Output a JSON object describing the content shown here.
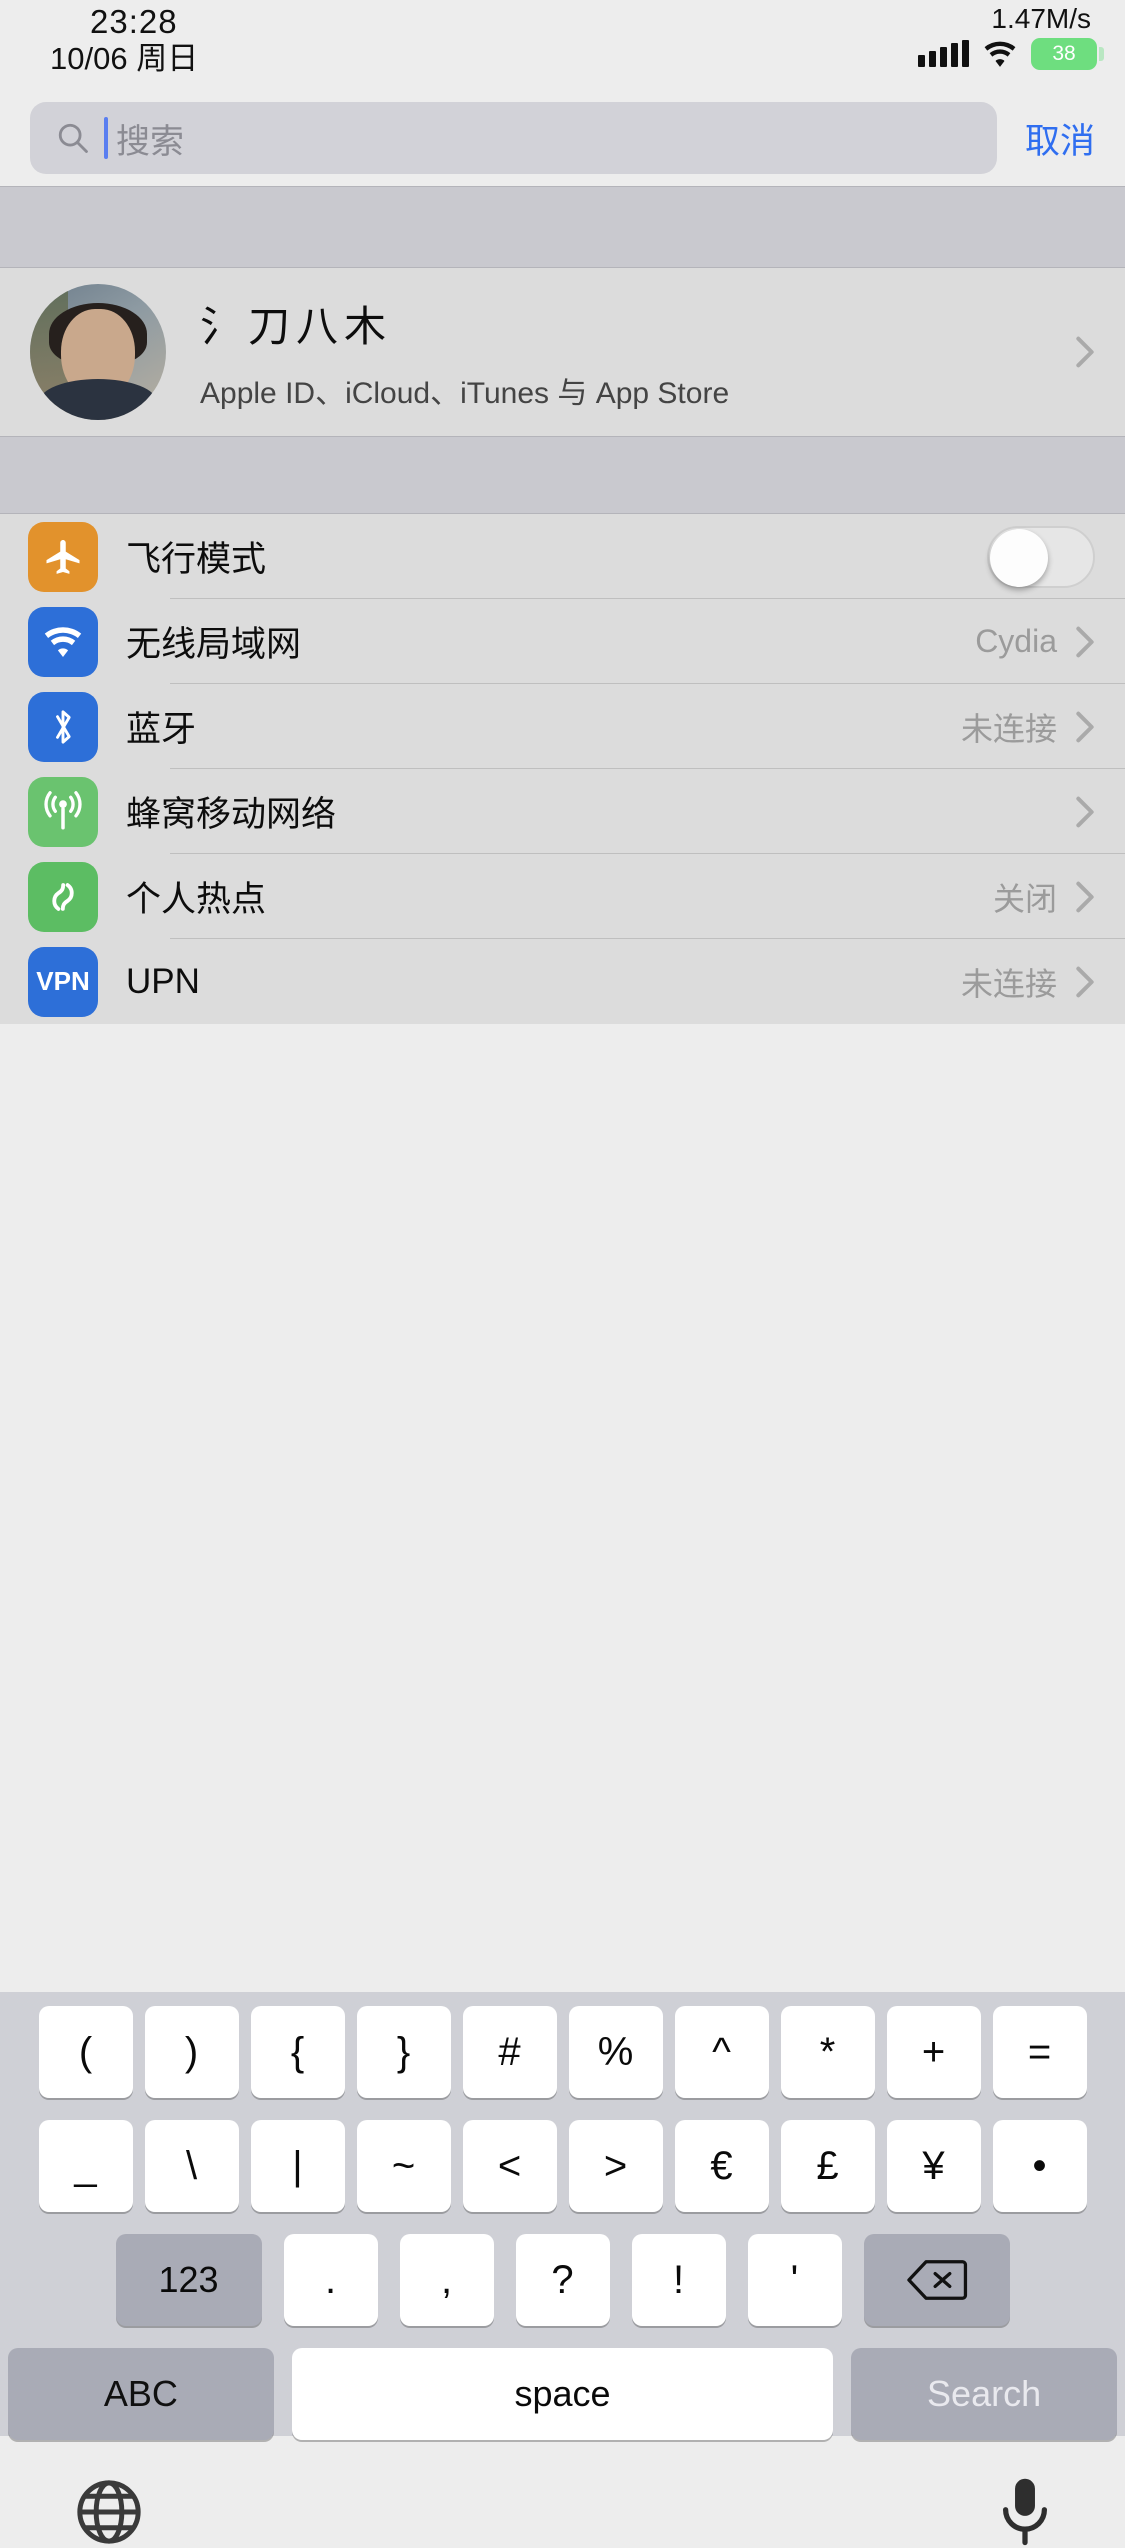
{
  "statusbar": {
    "time": "23:28",
    "date": "10/06 周日",
    "network_speed": "1.47M/s",
    "battery_level": "38",
    "battery_color": "#6ede7f",
    "signal_icon": "cellular-bars-icon",
    "wifi_icon": "wifi-icon"
  },
  "search": {
    "placeholder": "搜索",
    "value": "",
    "cancel_label": "取消",
    "icon": "search-icon",
    "accent_color": "#2f6ef0"
  },
  "profile": {
    "name": "氵刀八木",
    "subtitle": "Apple ID、iCloud、iTunes 与 App Store",
    "avatar": "user-avatar"
  },
  "settings": {
    "rows": [
      {
        "label": "飞行模式",
        "value": "",
        "icon": "airplane-icon",
        "control": "toggle",
        "toggle_on": false,
        "accent": "#e2922c"
      },
      {
        "label": "无线局域网",
        "value": "Cydia",
        "icon": "wifi-icon",
        "control": "chevron",
        "accent": "#2d6fd8"
      },
      {
        "label": "蓝牙",
        "value": "未连接",
        "icon": "bluetooth-icon",
        "control": "chevron",
        "accent": "#2d6fd8"
      },
      {
        "label": "蜂窝移动网络",
        "value": "",
        "icon": "cellular-icon",
        "control": "chevron",
        "accent": "#6ac36f"
      },
      {
        "label": "个人热点",
        "value": "关闭",
        "icon": "hotspot-icon",
        "control": "chevron",
        "accent": "#5cbd63"
      },
      {
        "label": "UPN",
        "value": "未连接",
        "icon": "vpn-icon",
        "icon_text": "VPN",
        "control": "chevron",
        "accent": "#2d6fd8"
      }
    ]
  },
  "keyboard": {
    "layout": "symbols",
    "row1": [
      "(",
      ")",
      "{",
      "}",
      "#",
      "%",
      "^",
      "*",
      "+",
      "="
    ],
    "row2": [
      "_",
      "\\",
      "|",
      "~",
      "<",
      ">",
      "€",
      "£",
      "¥",
      "•"
    ],
    "row3_symbols": [
      ".",
      ",",
      "?",
      "!",
      "'"
    ],
    "numeric_key": "123",
    "delete_key": "delete-icon",
    "abc_key": "ABC",
    "space_key": "space",
    "return_key": "Search",
    "globe_key": "globe-icon",
    "mic_key": "microphone-icon"
  }
}
